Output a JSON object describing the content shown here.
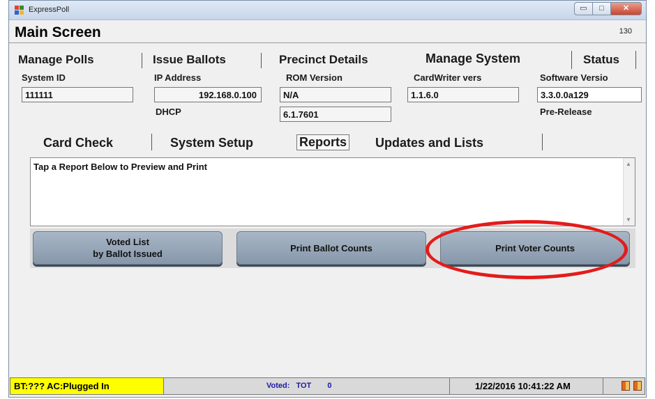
{
  "window": {
    "app_title": "ExpressPoll",
    "min_glyph": "▭",
    "max_glyph": "□",
    "close_glyph": "✕"
  },
  "header": {
    "title": "Main Screen",
    "number": "130"
  },
  "main_tabs": [
    "Manage Polls",
    "Issue Ballots",
    "Precinct Details",
    "Manage System",
    "Status"
  ],
  "system": {
    "system_id_label": "System ID",
    "system_id": "111111",
    "ip_label": "IP Address",
    "ip": "192.168.0.100",
    "dhcp_label": "DHCP",
    "rom_label": "ROM Version",
    "rom": "N/A",
    "rom_build": "6.1.7601",
    "cardwriter_label": "CardWriter vers",
    "cardwriter": "1.1.6.0",
    "software_label": "Software Versio",
    "software": "3.3.0.0a129",
    "release": "Pre-Release"
  },
  "sub_tabs": [
    "Card Check",
    "System Setup",
    "Reports",
    "Updates and Lists"
  ],
  "report_hint": "Tap a Report Below to Preview and Print",
  "report_buttons": [
    {
      "line1": "Voted List",
      "line2": "by Ballot Issued"
    },
    {
      "line1": "Print Ballot Counts",
      "line2": ""
    },
    {
      "line1": "Print Voter Counts",
      "line2": ""
    }
  ],
  "status": {
    "battery": "BT:??? AC:Plugged In",
    "voted_label": "Voted:",
    "voted_tot": "TOT",
    "voted_count": "0",
    "datetime": "1/22/2016 10:41:22 AM"
  },
  "colors": {
    "highlight_circle": "#e41b1b",
    "battery_bg": "#ffff00",
    "voted_text": "#1a1aa8"
  }
}
